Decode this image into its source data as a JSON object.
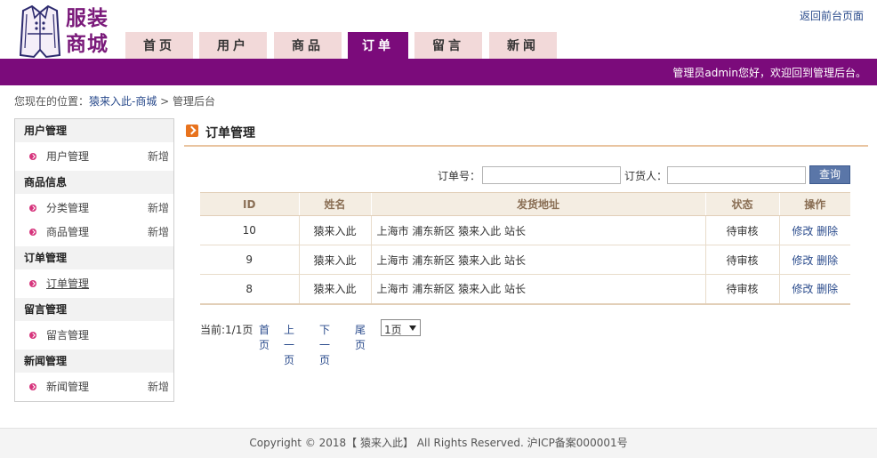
{
  "header": {
    "logo_text_1": "服装",
    "logo_text_2": "商城",
    "front_link": "返回前台页面",
    "nav": [
      "首页",
      "用户",
      "商品",
      "订单",
      "留言",
      "新闻"
    ]
  },
  "topbar": {
    "welcome": "管理员admin您好，欢迎回到管理后台。"
  },
  "breadcrumb": {
    "prefix": "您现在的位置：",
    "site": "猿来入此-商城",
    "sep": " > ",
    "current": "管理后台"
  },
  "sidebar": {
    "groups": [
      {
        "title": "用户管理",
        "items": [
          {
            "label": "用户管理",
            "add": "新增"
          }
        ]
      },
      {
        "title": "商品信息",
        "items": [
          {
            "label": "分类管理",
            "add": "新增"
          },
          {
            "label": "商品管理",
            "add": "新增"
          }
        ]
      },
      {
        "title": "订单管理",
        "items": [
          {
            "label": "订单管理"
          }
        ]
      },
      {
        "title": "留言管理",
        "items": [
          {
            "label": "留言管理"
          }
        ]
      },
      {
        "title": "新闻管理",
        "items": [
          {
            "label": "新闻管理",
            "add": "新增"
          }
        ]
      }
    ]
  },
  "main": {
    "title": "订单管理",
    "search": {
      "order_no_label": "订单号：",
      "order_no_value": "",
      "buyer_label": "订货人：",
      "buyer_value": "",
      "button": "查询"
    },
    "table": {
      "headers": [
        "ID",
        "姓名",
        "发货地址",
        "状态",
        "操作"
      ],
      "rows": [
        {
          "id": "10",
          "name": "猿来入此",
          "address": "上海市 浦东新区 猿来入此 站长",
          "status": "待审核",
          "edit": "修改",
          "delete": "删除"
        },
        {
          "id": "9",
          "name": "猿来入此",
          "address": "上海市 浦东新区 猿来入此 站长",
          "status": "待审核",
          "edit": "修改",
          "delete": "删除"
        },
        {
          "id": "8",
          "name": "猿来入此",
          "address": "上海市 浦东新区 猿来入此 站长",
          "status": "待审核",
          "edit": "修改",
          "delete": "删除"
        }
      ]
    },
    "pager": {
      "current": "当前:1/1页",
      "first": "首页",
      "prev": "上一页",
      "next": "下一页",
      "last": "尾页",
      "select_value": "1页"
    }
  },
  "footer": {
    "text": "Copyright © 2018【 猿来入此】 All Rights Reserved. 沪ICP备案000001号"
  },
  "colors": {
    "brand_purple": "#7b0b7b",
    "tab_pink": "#f2d9d9",
    "link_blue": "#2a4b8c",
    "table_head": "#f4ede2"
  }
}
